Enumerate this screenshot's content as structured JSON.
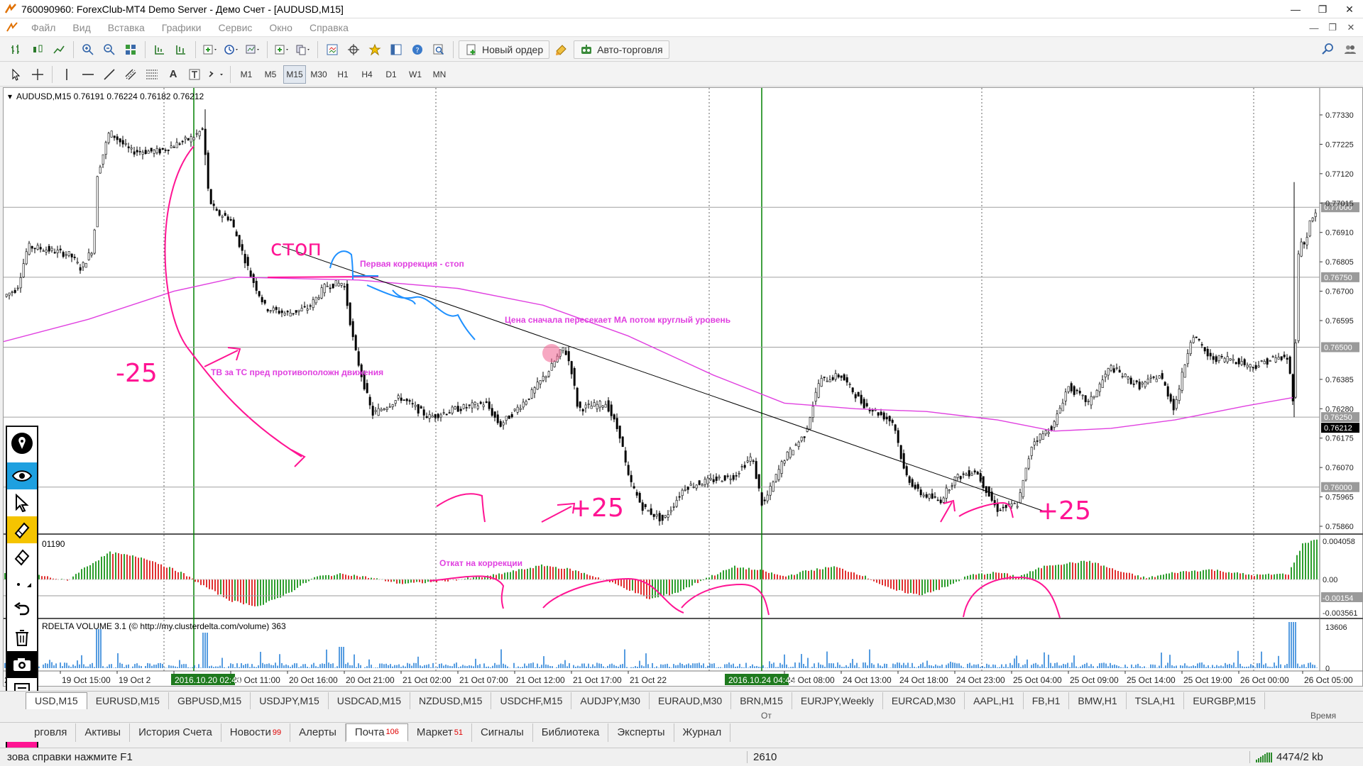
{
  "window": {
    "title": "760090960: ForexClub-MT4 Demo Server - Демо Счет - [AUDUSD,M15]"
  },
  "menu": [
    "Файл",
    "Вид",
    "Вставка",
    "Графики",
    "Сервис",
    "Окно",
    "Справка"
  ],
  "toolbar1": {
    "new_order": "Новый ордер",
    "auto_trading": "Авто-торговля"
  },
  "timeframes": [
    "M1",
    "M5",
    "M15",
    "M30",
    "H1",
    "H4",
    "D1",
    "W1",
    "MN"
  ],
  "active_timeframe": "M15",
  "chart": {
    "header": "AUDUSD,M15  0.76191 0.76224 0.76182 0.76212",
    "price_labels": [
      "0.77330",
      "0.77225",
      "0.77120",
      "0.77015",
      "0.76910",
      "0.76805",
      "0.76700",
      "0.76595",
      "0.76385",
      "0.76280",
      "0.76175",
      "0.76070",
      "0.75965",
      "0.75860"
    ],
    "level_labels": [
      "0.77000",
      "0.76750",
      "0.76500",
      "0.76250",
      "0.76000"
    ],
    "current_price": "0.76212",
    "time_labels": [
      "2016",
      "19 Oct 15:00",
      "19 Oct 2",
      "20 Oct 06:00",
      "20 Oct 11:00",
      "20 Oct 16:00",
      "20 Oct 21:00",
      "21 Oct 02:00",
      "21 Oct 07:00",
      "21 Oct 12:00",
      "21 Oct 17:00",
      "21 Oct 22",
      "24 Oct 08:00",
      "24 Oct 13:00",
      "24 Oct 18:00",
      "24 Oct 23:00",
      "25 Oct 04:00",
      "25 Oct 09:00",
      "25 Oct 14:00",
      "25 Oct 19:00",
      "26 Oct 00:00",
      "26 Oct 05:00"
    ],
    "time_highlight_1": "2016.10.20 02:45",
    "time_highlight_2": "2016.10.24 04:45",
    "osc_label": "01190",
    "osc_scale": [
      "0.004058",
      "0.00",
      "-0.00154",
      "-0.003561"
    ],
    "vol_label": "RDELTA VOLUME 3.1 (© http://my.clusterdelta.com/volume) 363",
    "vol_scale": [
      "13606",
      "0"
    ],
    "annotations": {
      "stop": "стоп",
      "first_correction": "Первая коррекция - стоп",
      "price_cross": "Цена сначала пересекает МА потом круглый уровень",
      "tv_tc": "ТВ за ТС пред противоположн движения",
      "minus25": "-25",
      "plus25_a": "+25",
      "plus25_b": "+25",
      "pullback": "Откат на коррекции"
    },
    "colors": {
      "ma": "#e040e0",
      "ink": "#ff1493",
      "blue_ink": "#1e90ff",
      "vline": "#008000",
      "bull": "#2e9e2e",
      "bear": "#e03030"
    }
  },
  "symbol_tabs": [
    "USD,M15",
    "EURUSD,M15",
    "GBPUSD,M15",
    "USDJPY,M15",
    "USDCAD,M15",
    "NZDUSD,M15",
    "USDCHF,M15",
    "AUDJPY,M30",
    "EURAUD,M30",
    "BRN,M15",
    "EURJPY,Weekly",
    "EURCAD,M30",
    "AAPL,H1",
    "FB,H1",
    "BMW,H1",
    "TSLA,H1",
    "EURGBP,M15"
  ],
  "terminal_header": {
    "col_time": "От",
    "col_time2": "Время"
  },
  "terminal_tabs": [
    {
      "label": "рговля",
      "badge": ""
    },
    {
      "label": "Активы",
      "badge": ""
    },
    {
      "label": "История Счета",
      "badge": ""
    },
    {
      "label": "Новости",
      "badge": "99"
    },
    {
      "label": "Алерты",
      "badge": ""
    },
    {
      "label": "Почта",
      "badge": "106"
    },
    {
      "label": "Маркет",
      "badge": "51"
    },
    {
      "label": "Сигналы",
      "badge": ""
    },
    {
      "label": "Библиотека",
      "badge": ""
    },
    {
      "label": "Эксперты",
      "badge": ""
    },
    {
      "label": "Журнал",
      "badge": ""
    }
  ],
  "active_terminal_tab": "Почта",
  "status": {
    "help": "Для вызова справки нажмите F1",
    "help_visible": "зова справки нажмите F1",
    "number": "2610",
    "connection": "4474/2 kb"
  }
}
